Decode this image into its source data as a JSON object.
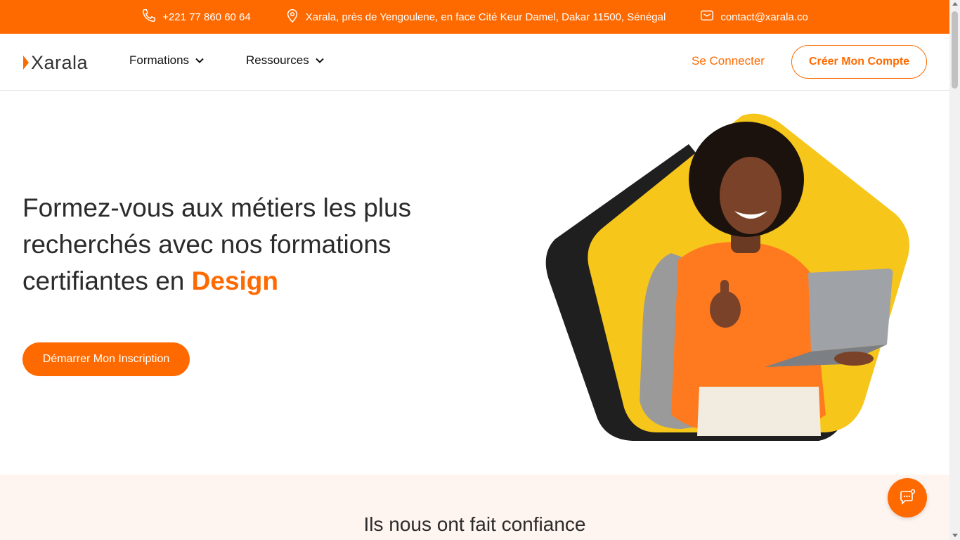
{
  "topbar": {
    "phone": "+221 77 860 60 64",
    "address": "Xarala, près de Yengoulene, en face Cité Keur Damel, Dakar 11500, Sénégal",
    "email": "contact@xarala.co"
  },
  "nav": {
    "logo": "Xarala",
    "menu": [
      {
        "label": "Formations"
      },
      {
        "label": "Ressources"
      }
    ],
    "login": "Se Connecter",
    "signup": "Créer Mon Compte"
  },
  "hero": {
    "title_prefix": "Formez-vous aux métiers les plus recherchés avec nos formations certifiantes en ",
    "title_accent": "Design",
    "cta": "Démarrer Mon Inscription"
  },
  "trust": {
    "title": "Ils nous ont fait confiance"
  },
  "colors": {
    "brand": "#ff6a00",
    "hero_yellow": "#f7c61b",
    "dark_shape": "#1f1f1f",
    "trust_bg": "#fff5f0"
  },
  "icons": [
    "phone-icon",
    "location-pin-icon",
    "mail-icon",
    "chevron-down-icon",
    "chat-icon"
  ]
}
